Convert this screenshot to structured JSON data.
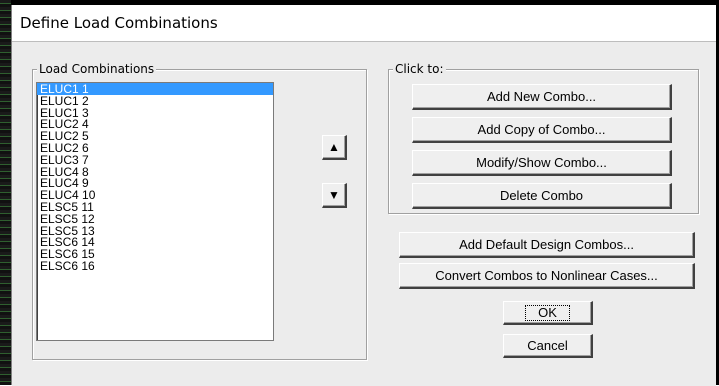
{
  "dialog": {
    "title": "Define Load Combinations"
  },
  "load_combinations": {
    "legend": "Load Combinations",
    "items": [
      "ELUC1 1",
      "ELUC1 2",
      "ELUC1 3",
      "ELUC2 4",
      "ELUC2 5",
      "ELUC2 6",
      "ELUC3 7",
      "ELUC4 8",
      "ELUC4 9",
      "ELUC4 10",
      "ELSC5 11",
      "ELSC5 12",
      "ELSC5 13",
      "ELSC6 14",
      "ELSC6 15",
      "ELSC6 16"
    ],
    "selected": "ELUC1 1"
  },
  "reorder": {
    "up_icon": "arrow-up-icon",
    "down_icon": "arrow-down-icon",
    "up_glyph": "▲",
    "down_glyph": "▼"
  },
  "click_to": {
    "legend": "Click to:",
    "add_new": "Add New Combo...",
    "add_copy": "Add Copy of Combo...",
    "modify": "Modify/Show Combo...",
    "delete": "Delete Combo"
  },
  "actions": {
    "add_default": "Add Default Design Combos...",
    "convert": "Convert Combos to Nonlinear Cases...",
    "ok": "OK",
    "cancel": "Cancel"
  },
  "colors": {
    "selection": "#3399ff"
  }
}
